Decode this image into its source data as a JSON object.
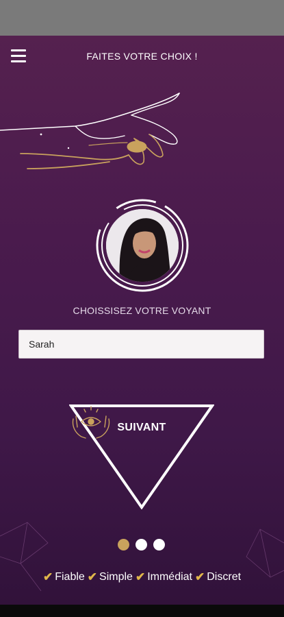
{
  "header": {
    "title": "FAITES VOTRE CHOIX !"
  },
  "main": {
    "choose_label": "CHOISSISEZ VOTRE VOYANT",
    "selected_voyant": "Sarah",
    "next_label": "SUIVANT"
  },
  "pager": {
    "count": 3,
    "active_index": 0
  },
  "features": [
    "Fiable",
    "Simple",
    "Immédiat",
    "Discret"
  ],
  "colors": {
    "accent_gold": "#c9a25d",
    "background": "#4a1b4d",
    "check": "#e0b64a"
  },
  "icons": {
    "menu": "hamburger-icon",
    "check": "check-icon",
    "mystic": "eye-hands-icon"
  }
}
